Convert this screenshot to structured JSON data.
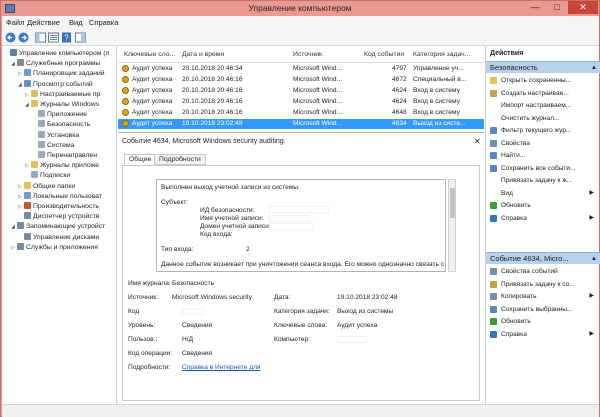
{
  "window": {
    "title": "Управление компьютером",
    "controls": [
      "—",
      "□",
      "✕"
    ]
  },
  "menu": [
    "Файл",
    "Действие",
    "Вид",
    "Справка"
  ],
  "colors": {
    "selection": "#3399ff",
    "titlebar": "#e89a91",
    "section_header": "#b7d0ec",
    "link": "#1a56b8"
  },
  "tree": [
    {
      "label": "Управление компьютером (л",
      "level": 0,
      "exp": "",
      "icon": "computer-icon",
      "color": "#5a7fb0"
    },
    {
      "label": "Служебные программы",
      "level": 1,
      "exp": "◢",
      "icon": "tools-icon",
      "color": "#8a8a8a"
    },
    {
      "label": "Планировщик заданий",
      "level": 2,
      "exp": "▷",
      "icon": "clock-icon",
      "color": "#6b9bd1"
    },
    {
      "label": "Просмотр событий",
      "level": 2,
      "exp": "◢",
      "icon": "event-viewer-icon",
      "color": "#6b8fc7"
    },
    {
      "label": "Настраиваемые пр",
      "level": 3,
      "exp": "▷",
      "icon": "folder-icon",
      "color": "#e3c15a"
    },
    {
      "label": "Журналы Windows",
      "level": 3,
      "exp": "◢",
      "icon": "folder-icon",
      "color": "#e3c15a"
    },
    {
      "label": "Приложение",
      "level": 4,
      "exp": "",
      "icon": "log-icon",
      "color": "#9aa9bd"
    },
    {
      "label": "Безопасность",
      "level": 4,
      "exp": "",
      "icon": "log-icon",
      "color": "#9aa9bd"
    },
    {
      "label": "Установка",
      "level": 4,
      "exp": "",
      "icon": "log-icon",
      "color": "#9aa9bd"
    },
    {
      "label": "Система",
      "level": 4,
      "exp": "",
      "icon": "log-icon",
      "color": "#9aa9bd"
    },
    {
      "label": "Перенаправлен",
      "level": 4,
      "exp": "",
      "icon": "log-icon",
      "color": "#9aa9bd"
    },
    {
      "label": "Журналы приложе",
      "level": 3,
      "exp": "▷",
      "icon": "folder-icon",
      "color": "#e3c15a"
    },
    {
      "label": "Подписки",
      "level": 3,
      "exp": "",
      "icon": "subscription-icon",
      "color": "#9aa9bd"
    },
    {
      "label": "Общие папки",
      "level": 2,
      "exp": "▷",
      "icon": "shared-folder-icon",
      "color": "#e3c15a"
    },
    {
      "label": "Локальные пользоват",
      "level": 2,
      "exp": "▷",
      "icon": "users-icon",
      "color": "#6b9bd1"
    },
    {
      "label": "Производительность",
      "level": 2,
      "exp": "▷",
      "icon": "performance-icon",
      "color": "#c4553a"
    },
    {
      "label": "Диспетчер устройств",
      "level": 2,
      "exp": "",
      "icon": "device-manager-icon",
      "color": "#7a8aa0"
    },
    {
      "label": "Запоминающие устройст",
      "level": 1,
      "exp": "◢",
      "icon": "storage-icon",
      "color": "#7a8aa0"
    },
    {
      "label": "Управление дисками",
      "level": 2,
      "exp": "",
      "icon": "disk-icon",
      "color": "#7a8aa0"
    },
    {
      "label": "Службы и приложения",
      "level": 1,
      "exp": "▷",
      "icon": "services-icon",
      "color": "#7a8aa0"
    }
  ],
  "events": {
    "columns": [
      "Ключевые сло...",
      "Дата и время",
      "Источник",
      "Код события",
      "Категория задач..."
    ],
    "rows": [
      {
        "keywords": "Аудит успеха",
        "date": "20.10.2018 20:46:34",
        "source": "Microsoft Wind...",
        "code": "4797",
        "category": "Управление уч...",
        "selected": false
      },
      {
        "keywords": "Аудит успеха",
        "date": "20.10.2018 20:46:16",
        "source": "Microsoft Wind...",
        "code": "4672",
        "category": "Специальный в...",
        "selected": false
      },
      {
        "keywords": "Аудит успеха",
        "date": "20.10.2018 20:46:16",
        "source": "Microsoft Wind...",
        "code": "4624",
        "category": "Вход в систему",
        "selected": false
      },
      {
        "keywords": "Аудит успеха",
        "date": "20.10.2018 20:46:16",
        "source": "Microsoft Wind...",
        "code": "4624",
        "category": "Вход в систему",
        "selected": false
      },
      {
        "keywords": "Аудит успеха",
        "date": "20.10.2018 20:46:16",
        "source": "Microsoft Wind...",
        "code": "4648",
        "category": "Вход в систему",
        "selected": false
      },
      {
        "keywords": "Аудит успеха",
        "date": "19.10.2018 23:02:48",
        "source": "Microsoft Wind...",
        "code": "4634",
        "category": "Выход из систе...",
        "selected": true
      }
    ]
  },
  "detail": {
    "title": "Событие 4634, Microsoft Windows security auditing.",
    "close": "✕",
    "tabs": [
      "Общие",
      "Подробности"
    ],
    "description": {
      "line1": "Выполнен выход учетной записи из системы.",
      "subject": "Субъект:",
      "sid": "ИД безопасности:",
      "account_name": "Имя учетной записи:",
      "account_domain": "Домен учетной записи:",
      "logon_id": "Код входа:",
      "logon_type_label": "Тип входа:",
      "logon_type_value": "2",
      "footer": "Данное событие возникает при уничтожении сеанса входа. Его можно однозначно связать с"
    },
    "fields": {
      "log_name_label": "Имя журнала:",
      "log_name_value": "Безопасность",
      "source_label": "Источник:",
      "source_value": "Microsoft Windows security",
      "logged_label": "Дата:",
      "logged_value": "19.10.2018 23:02:48",
      "code_label": "Код",
      "category_label": "Категория задачи:",
      "category_value": "Выход из системы",
      "level_label": "Уровень:",
      "level_value": "Сведения",
      "keywords_label": "Ключевые слова:",
      "keywords_value": "Аудит успеха",
      "user_label": "Пользов.:",
      "user_value": "Н/Д",
      "computer_label": "Компьютер:",
      "opcode_label": "Код операции:",
      "opcode_value": "Сведения",
      "more_label": "Подробности:",
      "more_link": "Справка в Интернете для"
    }
  },
  "actions": {
    "header": "Действия",
    "section1": {
      "title": "Безопасность",
      "items": [
        {
          "label": "Открыть сохраненны...",
          "icon": "open-icon",
          "color": "#e3c15a",
          "submenu": false
        },
        {
          "label": "Создать настраивае...",
          "icon": "filter-create-icon",
          "color": "#c7a04a",
          "submenu": false
        },
        {
          "label": "Импорт настраиваем...",
          "icon": "",
          "color": "",
          "submenu": false
        },
        {
          "label": "Очистить журнал...",
          "icon": "",
          "color": "",
          "submenu": false
        },
        {
          "label": "Фильтр текущего жур...",
          "icon": "filter-icon",
          "color": "#5b86c4",
          "submenu": false
        },
        {
          "label": "Свойства",
          "icon": "properties-icon",
          "color": "#7a8aa0",
          "submenu": false
        },
        {
          "label": "Найти...",
          "icon": "find-icon",
          "color": "#5b86c4",
          "submenu": false
        },
        {
          "label": "Сохранить все событи...",
          "icon": "save-icon",
          "color": "#5b86c4",
          "submenu": false
        },
        {
          "label": "Привязать задачу к ж...",
          "icon": "",
          "color": "",
          "submenu": false
        },
        {
          "label": "Вид",
          "icon": "",
          "color": "",
          "submenu": true
        },
        {
          "label": "Обновить",
          "icon": "refresh-icon",
          "color": "#3f9a3a",
          "submenu": false
        },
        {
          "label": "Справка",
          "icon": "help-icon",
          "color": "#3d6fc0",
          "submenu": true
        }
      ]
    },
    "section2": {
      "title": "Событие 4634, Micro...",
      "items": [
        {
          "label": "Свойства событий",
          "icon": "event-properties-icon",
          "color": "#7a8aa0",
          "submenu": false
        },
        {
          "label": "Привязать задачу к со...",
          "icon": "attach-task-icon",
          "color": "#c7a04a",
          "submenu": false
        },
        {
          "label": "Копировать",
          "icon": "copy-icon",
          "color": "#7a8aa0",
          "submenu": true
        },
        {
          "label": "Сохранить выбранны...",
          "icon": "save-icon",
          "color": "#5b86c4",
          "submenu": false
        },
        {
          "label": "Обновить",
          "icon": "refresh-icon",
          "color": "#3f9a3a",
          "submenu": false
        },
        {
          "label": "Справка",
          "icon": "help-icon",
          "color": "#3d6fc0",
          "submenu": true
        }
      ]
    }
  }
}
